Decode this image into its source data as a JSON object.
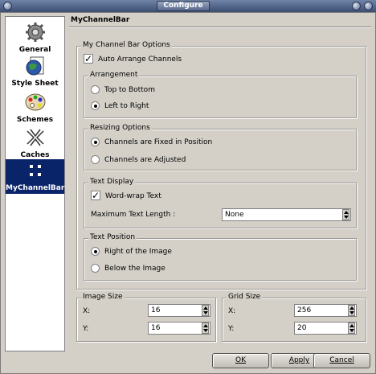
{
  "window": {
    "title": "Configure"
  },
  "sidebar": {
    "items": [
      {
        "label": "General",
        "icon": "gear-icon"
      },
      {
        "label": "Style Sheet",
        "icon": "stylesheet-icon"
      },
      {
        "label": "Schemes",
        "icon": "palette-icon"
      },
      {
        "label": "Caches",
        "icon": "caches-icon"
      },
      {
        "label": "MyChannelBar",
        "icon": "channelbar-icon",
        "selected": true
      }
    ]
  },
  "panel": {
    "title": "MyChannelBar"
  },
  "options": {
    "group_label": "My Channel Bar Options",
    "auto_arrange": {
      "label": "Auto Arrange Channels",
      "checked": true
    },
    "arrangement": {
      "label": "Arrangement",
      "options": [
        "Top to Bottom",
        "Left to Right"
      ],
      "selected": "Left to Right"
    },
    "resizing": {
      "label": "Resizing Options",
      "options": [
        "Channels are Fixed in Position",
        "Channels are Adjusted"
      ],
      "selected": "Channels are Fixed in Position"
    },
    "text_display": {
      "label": "Text Display",
      "word_wrap": {
        "label": "Word-wrap Text",
        "checked": true
      },
      "max_length_label": "Maximum Text Length :",
      "max_length_value": "None"
    },
    "text_position": {
      "label": "Text Position",
      "options": [
        "Right of the Image",
        "Below the Image"
      ],
      "selected": "Right of the Image"
    }
  },
  "image_size": {
    "label": "Image Size",
    "x_label": "X:",
    "x": "16",
    "y_label": "Y:",
    "y": "16"
  },
  "grid_size": {
    "label": "Grid Size",
    "x_label": "X:",
    "x": "256",
    "y_label": "Y:",
    "y": "20"
  },
  "buttons": {
    "ok": "OK",
    "apply": "Apply",
    "cancel": "Cancel"
  },
  "colors": {
    "titlebar": "#4b5e84",
    "selection": "#0a246a",
    "background": "#d4d0c8"
  }
}
